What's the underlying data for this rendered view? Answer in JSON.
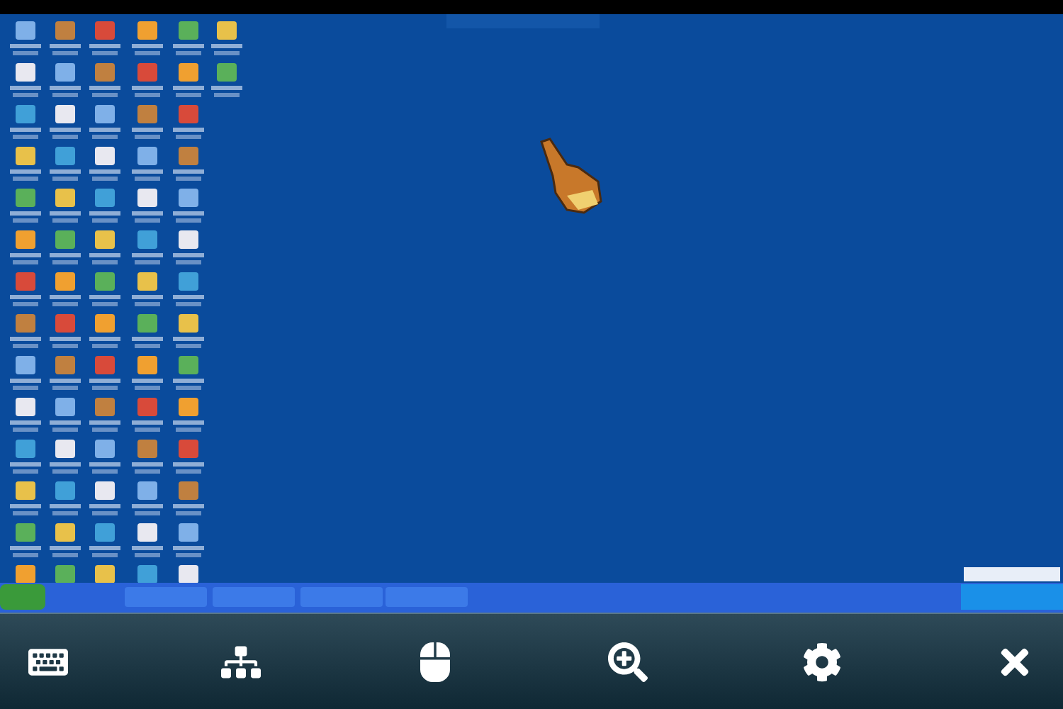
{
  "toolbar": {
    "buttons": [
      {
        "kind": "keyboard"
      },
      {
        "kind": "network"
      },
      {
        "kind": "mouse"
      },
      {
        "kind": "zoom"
      },
      {
        "kind": "settings"
      },
      {
        "kind": "close"
      }
    ]
  }
}
